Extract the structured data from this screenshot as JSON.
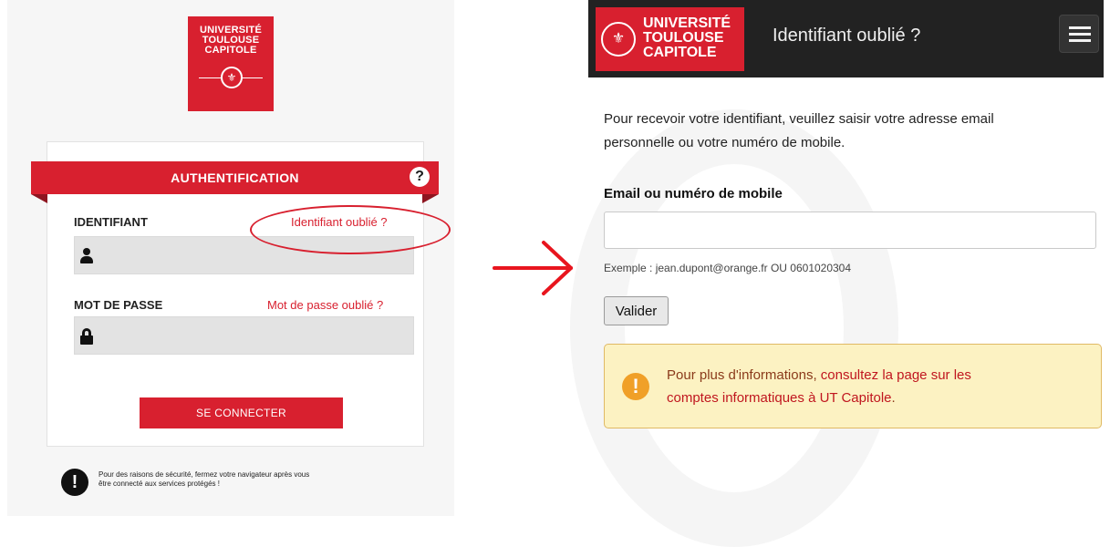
{
  "login": {
    "logo_lines": [
      "UNIVERSITÉ",
      "TOULOUSE",
      "CAPITOLE"
    ],
    "heading": "AUTHENTIFICATION",
    "help_glyph": "?",
    "username_label": "IDENTIFIANT",
    "username_forgot": "Identifiant oublié ?",
    "password_label": "MOT DE PASSE",
    "password_forgot": "Mot de passe oublié ?",
    "submit_label": "SE CONNECTER",
    "security_notice_line1": "Pour des raisons de sécurité, fermez votre navigateur après vous",
    "security_notice_line2": "être connecté aux services protégés !"
  },
  "recovery": {
    "logo_lines": [
      "UNIVERSITÉ",
      "TOULOUSE",
      "CAPITOLE"
    ],
    "page_title": "Identifiant oublié ?",
    "intro_line1": "Pour recevoir votre identifiant, veuillez saisir votre adresse email",
    "intro_line2": "personnelle ou votre numéro de mobile.",
    "field_label": "Email ou numéro de mobile",
    "field_value": "",
    "example": "Exemple : jean.dupont@orange.fr OU 0601020304",
    "validate_label": "Valider",
    "info_prefix": "Pour plus d'informations, ",
    "info_link_1": "consultez la page sur les",
    "info_link_2": "comptes informatiques à UT Capitole",
    "info_suffix": "."
  },
  "colors": {
    "brand_red": "#d8202f",
    "topbar": "#222222",
    "info_bg": "#fcf2c2",
    "info_border": "#e0b964",
    "warning_orange": "#f0a028"
  }
}
